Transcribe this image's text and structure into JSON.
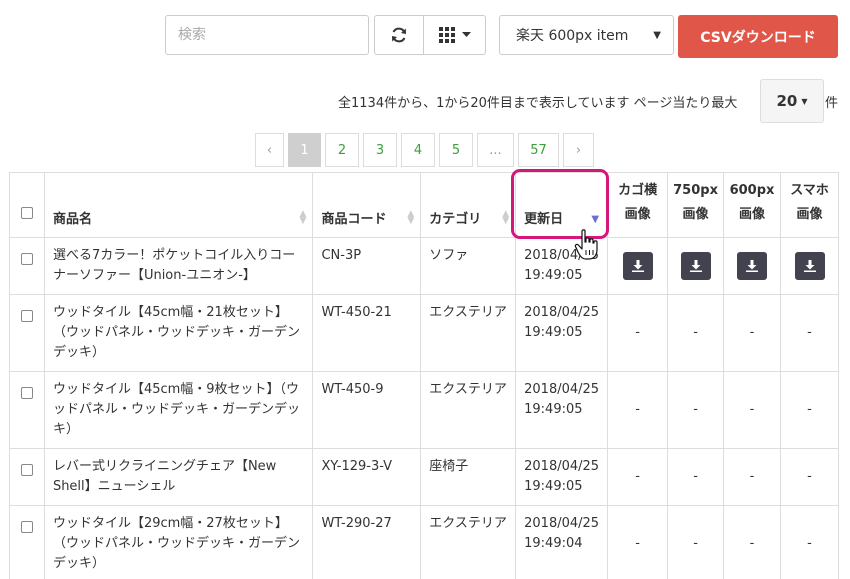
{
  "toolbar": {
    "search_placeholder": "検索",
    "refresh_icon": "refresh-icon",
    "grid_icon": "grid-icon",
    "select_value": "楽天 600px item",
    "csv_label": "CSVダウンロード"
  },
  "info": {
    "text": "全1134件から、1から20件目まで表示しています ページ当たり最大",
    "per_page": "20",
    "unit": "件"
  },
  "pagination": [
    "‹",
    "1",
    "2",
    "3",
    "4",
    "5",
    "...",
    "57",
    "›"
  ],
  "table": {
    "headers": {
      "name": "商品名",
      "code": "商品コード",
      "category": "カテゴリ",
      "updated": "更新日",
      "cart_l1": "カゴ横",
      "cart_l2": "画像",
      "px750_l1": "750px",
      "px750_l2": "画像",
      "px600_l1": "600px",
      "px600_l2": "画像",
      "sp_l1": "スマホ",
      "sp_l2": "画像"
    },
    "rows": [
      {
        "name": "選べる7カラー！ポケットコイル入りコーナーソファー【Union-ユニオン-】",
        "code": "CN-3P",
        "category": "ソファ",
        "date": "2018/04/25",
        "time": "19:49:05",
        "cart": "",
        "px750": "",
        "px600": "",
        "sp": ""
      },
      {
        "name": "ウッドタイル【45cm幅・21枚セット】（ウッドパネル・ウッドデッキ・ガーデンデッキ）",
        "code": "WT-450-21",
        "category": "エクステリア",
        "date": "2018/04/25",
        "time": "19:49:05",
        "cart": "-",
        "px750": "-",
        "px600": "-",
        "sp": "-"
      },
      {
        "name": "ウッドタイル【45cm幅・9枚セット】（ウッドパネル・ウッドデッキ・ガーデンデッキ）",
        "code": "WT-450-9",
        "category": "エクステリア",
        "date": "2018/04/25",
        "time": "19:49:05",
        "cart": "-",
        "px750": "-",
        "px600": "-",
        "sp": "-"
      },
      {
        "name": "レバー式リクライニングチェア【New Shell】ニューシェル",
        "code": "XY-129-3-V",
        "category": "座椅子",
        "date": "2018/04/25",
        "time": "19:49:05",
        "cart": "-",
        "px750": "-",
        "px600": "-",
        "sp": "-"
      },
      {
        "name": "ウッドタイル【29cm幅・27枚セット】（ウッドパネル・ウッドデッキ・ガーデンデッキ）",
        "code": "WT-290-27",
        "category": "エクステリア",
        "date": "2018/04/25",
        "time": "19:49:04",
        "cart": "-",
        "px750": "-",
        "px600": "-",
        "sp": "-"
      }
    ]
  },
  "colors": {
    "csv_button": "#e0574a",
    "highlight": "#d5167f",
    "link": "#3c9e3c",
    "download_button": "#43434f",
    "sort_active": "#6b6fd4"
  }
}
